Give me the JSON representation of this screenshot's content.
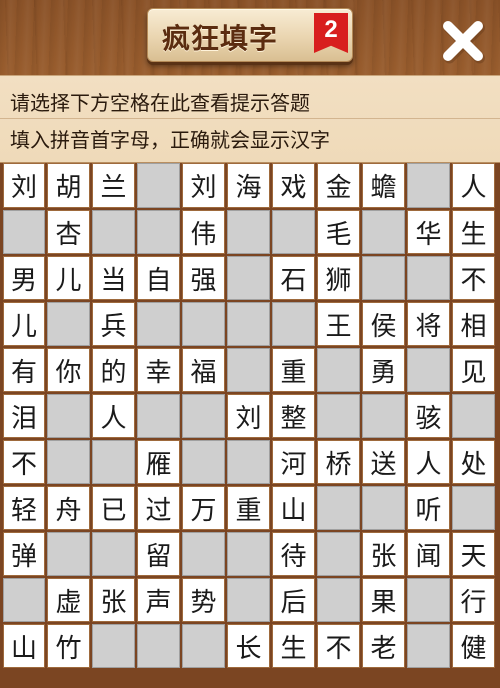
{
  "header": {
    "title": "疯狂填字",
    "level_badge": "2",
    "close_label": "×"
  },
  "hints": {
    "line1": "请选择下方空格在此查看提示答题",
    "line2": "填入拼音首字母，正确就会显示汉字"
  },
  "colors": {
    "wood": "#8a5228",
    "panel": "#f0dcbd",
    "cell_white": "#ffffff",
    "cell_gray": "#cfcfcf",
    "badge_red": "#d81e1e"
  },
  "board": {
    "cols": 11,
    "rows": 11,
    "cells": [
      [
        "W:刘",
        "W:胡",
        "W:兰",
        "G",
        "W:刘",
        "W:海",
        "W:戏",
        "W:金",
        "W:蟾",
        "G",
        "W:人"
      ],
      [
        "G",
        "W:杏",
        "G",
        "G",
        "W:伟",
        "G",
        "G",
        "W:毛",
        "G",
        "W:华",
        "W:生"
      ],
      [
        "W:男",
        "W:儿",
        "W:当",
        "W:自",
        "W:强",
        "G",
        "W:石",
        "W:狮",
        "G",
        "G",
        "W:不"
      ],
      [
        "W:儿",
        "G",
        "W:兵",
        "G",
        "G",
        "G",
        "G",
        "W:王",
        "W:侯",
        "W:将",
        "W:相"
      ],
      [
        "W:有",
        "W:你",
        "W:的",
        "W:幸",
        "W:福",
        "G",
        "W:重",
        "G",
        "W:勇",
        "G",
        "W:见"
      ],
      [
        "W:泪",
        "G",
        "W:人",
        "G",
        "G",
        "W:刘",
        "W:整",
        "G",
        "G",
        "W:骇",
        "G"
      ],
      [
        "W:不",
        "G",
        "G",
        "W:雁",
        "G",
        "G",
        "W:河",
        "W:桥",
        "W:送",
        "W:人",
        "W:处"
      ],
      [
        "W:轻",
        "W:舟",
        "W:已",
        "W:过",
        "W:万",
        "W:重",
        "W:山",
        "G",
        "G",
        "W:听",
        "G"
      ],
      [
        "W:弹",
        "G",
        "G",
        "W:留",
        "G",
        "G",
        "W:待",
        "G",
        "W:张",
        "W:闻",
        "W:天"
      ],
      [
        "G",
        "W:虚",
        "W:张",
        "W:声",
        "W:势",
        "G",
        "W:后",
        "G",
        "W:果",
        "G",
        "W:行"
      ],
      [
        "W:山",
        "W:竹",
        "G",
        "G",
        "G",
        "W:长",
        "W:生",
        "W:不",
        "W:老",
        "G",
        "W:健"
      ]
    ]
  }
}
